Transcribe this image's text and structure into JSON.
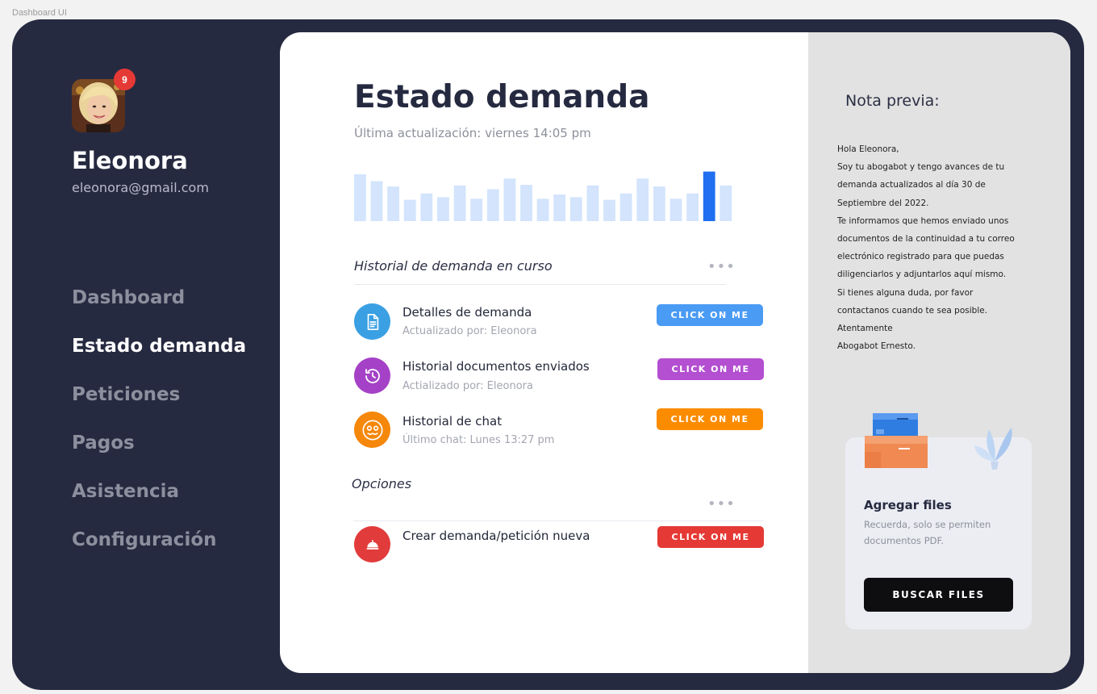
{
  "frame_label": "Dashboard UI",
  "user": {
    "name": "Eleonora",
    "email": "eleonora@gmail.com",
    "notifications": "9"
  },
  "nav": {
    "items": [
      {
        "label": "Dashboard",
        "active": false
      },
      {
        "label": "Estado demanda",
        "active": true
      },
      {
        "label": "Peticiones",
        "active": false
      },
      {
        "label": "Pagos",
        "active": false
      },
      {
        "label": "Asistencia",
        "active": false
      },
      {
        "label": "Configuración",
        "active": false
      }
    ]
  },
  "main": {
    "title": "Estado demanda",
    "subtitle": "Última actualización: viernes 14:05 pm",
    "activity_bars": [
      0.88,
      0.75,
      0.65,
      0.4,
      0.52,
      0.45,
      0.67,
      0.42,
      0.6,
      0.8,
      0.68,
      0.42,
      0.5,
      0.45,
      0.67,
      0.4,
      0.52,
      0.8,
      0.65,
      0.42,
      0.52,
      0.93,
      0.67
    ],
    "activity_highlight_index": 21,
    "history_heading": "Historial de demanda en curso",
    "history": [
      {
        "title": "Detalles de demanda",
        "sub": "Actualizado por: Eleonora",
        "button": "CLICK ON ME",
        "color": "#3aa0e3",
        "button_color": "#4a9bf4",
        "icon": "document-icon"
      },
      {
        "title": "Historial documentos enviados",
        "sub": "Actializado por: Eleonora",
        "button": "CLICK ON ME",
        "color": "#a541c7",
        "button_color": "#b34fd0",
        "icon": "history-icon"
      },
      {
        "title": "Historial de chat",
        "sub": "Último chat: Lunes 13:27 pm",
        "button": "CLICK ON ME",
        "color": "#f5870a",
        "button_color": "#fb8c00",
        "icon": "chat-bot-icon"
      }
    ],
    "options_heading": "Opciones",
    "options": [
      {
        "title": "Crear demanda/petición nueva",
        "button": "CLICK ON ME",
        "color": "#e23b3b",
        "button_color": "#e53935",
        "icon": "service-bell-icon"
      }
    ]
  },
  "note": {
    "title": "Nota previa:",
    "lines": [
      "Hola Eleonora,",
      "Soy tu abogabot y tengo avances de tu",
      "demanda actualizados al día 30 de",
      "Septiembre del 2022.",
      "Te informamos que hemos enviado unos",
      "documentos de la continuidad a tu correo",
      "electrónico registrado para que puedas",
      "diligenciarlos y adjuntarlos aquí mismo.",
      "Si tienes alguna duda, por favor",
      "contactanos cuando te sea posible.",
      "Atentamente",
      "Abogabot Ernesto."
    ]
  },
  "upload": {
    "title": "Agregar files",
    "hint": "Recuerda, solo se permiten documentos PDF.",
    "button": "BUSCAR FILES"
  }
}
